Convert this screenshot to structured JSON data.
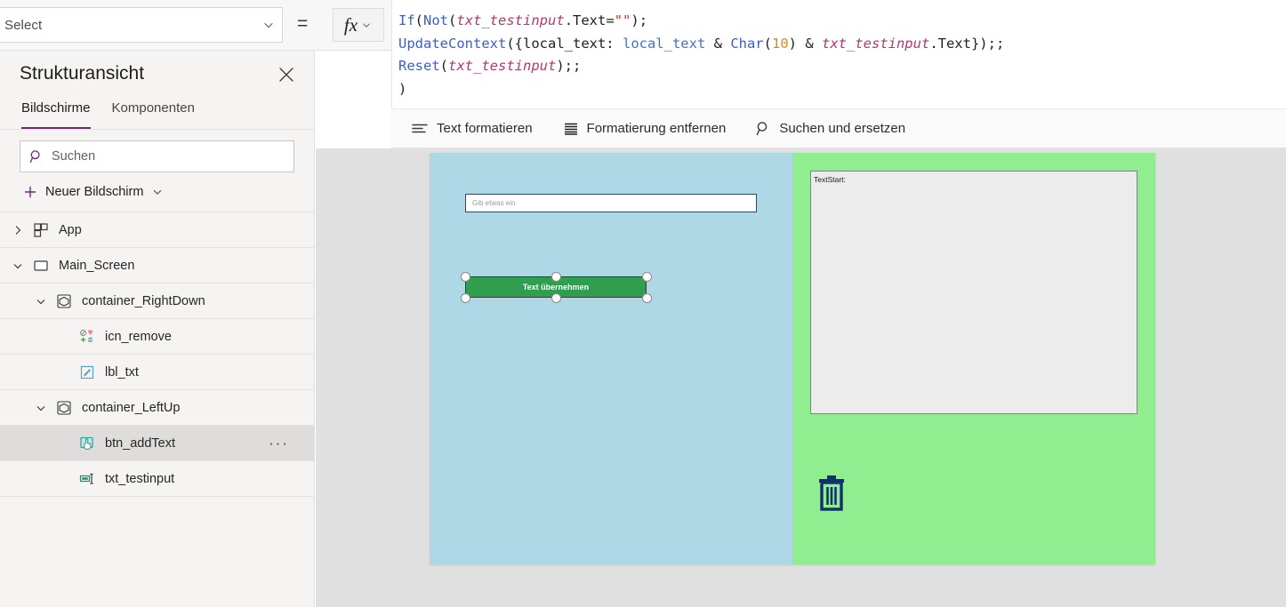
{
  "topbar": {
    "property_select": {
      "value": "Select",
      "icon": "chevron-down-icon"
    },
    "equals": "=",
    "fx_label": "fx"
  },
  "formula": {
    "lines": [
      [
        {
          "t": "If",
          "c": "fn"
        },
        {
          "t": "(",
          "c": "plain"
        },
        {
          "t": "Not",
          "c": "fn"
        },
        {
          "t": "(",
          "c": "plain"
        },
        {
          "t": "txt_testinput",
          "c": "ctrl"
        },
        {
          "t": ".Text=",
          "c": "plain"
        },
        {
          "t": "\"\"",
          "c": "str"
        },
        {
          "t": ");",
          "c": "plain"
        }
      ],
      [
        {
          "t": "UpdateContext",
          "c": "fn"
        },
        {
          "t": "({local_text: ",
          "c": "plain"
        },
        {
          "t": "local_text",
          "c": "var"
        },
        {
          "t": " & ",
          "c": "plain"
        },
        {
          "t": "Char",
          "c": "fn"
        },
        {
          "t": "(",
          "c": "plain"
        },
        {
          "t": "10",
          "c": "num"
        },
        {
          "t": ") & ",
          "c": "plain"
        },
        {
          "t": "txt_testinput",
          "c": "ctrl"
        },
        {
          "t": ".Text});;",
          "c": "plain"
        }
      ],
      [
        {
          "t": "Reset",
          "c": "fn"
        },
        {
          "t": "(",
          "c": "plain"
        },
        {
          "t": "txt_testinput",
          "c": "ctrl"
        },
        {
          "t": ");;",
          "c": "plain"
        }
      ],
      [
        {
          "t": ")",
          "c": "plain"
        }
      ]
    ],
    "toolbar": [
      {
        "label": "Text formatieren",
        "icon": "format-text-icon"
      },
      {
        "label": "Formatierung entfernen",
        "icon": "remove-formatting-icon"
      },
      {
        "label": "Suchen und ersetzen",
        "icon": "search-icon"
      }
    ]
  },
  "tree_panel": {
    "title": "Strukturansicht",
    "close_icon": "close-icon",
    "tabs": [
      {
        "label": "Bildschirme",
        "active": true
      },
      {
        "label": "Komponenten",
        "active": false
      }
    ],
    "search": {
      "placeholder": "Suchen",
      "icon": "search-icon"
    },
    "new_screen": {
      "label": "Neuer Bildschirm",
      "icon": "plus-icon",
      "chevron": "chevron-down-icon"
    },
    "items": [
      {
        "label": "App",
        "indent": 0,
        "icon": "app-icon",
        "twisty": "collapsed",
        "selected": false,
        "more": false
      },
      {
        "label": "Main_Screen",
        "indent": 0,
        "icon": "screen-icon",
        "twisty": "expanded",
        "selected": false,
        "more": false
      },
      {
        "label": "container_RightDown",
        "indent": 1,
        "icon": "container-icon",
        "twisty": "expanded",
        "selected": false,
        "more": false
      },
      {
        "label": "icn_remove",
        "indent": 2,
        "icon": "icon-control-icon",
        "twisty": "none",
        "selected": false,
        "more": false
      },
      {
        "label": "lbl_txt",
        "indent": 2,
        "icon": "label-icon",
        "twisty": "none",
        "selected": false,
        "more": false
      },
      {
        "label": "container_LeftUp",
        "indent": 1,
        "icon": "container-icon",
        "twisty": "expanded",
        "selected": false,
        "more": false
      },
      {
        "label": "btn_addText",
        "indent": 2,
        "icon": "button-icon",
        "twisty": "none",
        "selected": true,
        "more": true,
        "more_label": "···"
      },
      {
        "label": "txt_testinput",
        "indent": 2,
        "icon": "textinput-icon",
        "twisty": "none",
        "selected": false,
        "more": false
      }
    ]
  },
  "canvas": {
    "left_pane_color": "#aed8e6",
    "right_pane_color": "#90ee90",
    "text_input": {
      "placeholder": "Gib etwas ein"
    },
    "button": {
      "label": "Text übernehmen",
      "fill": "#2f9e4f",
      "selected": true
    },
    "label": {
      "text": "TextStart:",
      "fill": "#ececec"
    },
    "trash_icon": {
      "name": "trash-icon",
      "color": "#12306b"
    }
  }
}
